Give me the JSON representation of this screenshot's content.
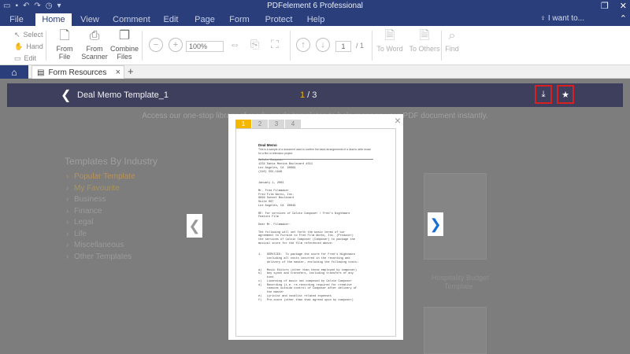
{
  "titlebar": {
    "title": "PDFelement 6 Professional",
    "quick_access": [
      "folder-icon",
      "save-icon",
      "undo-icon",
      "redo-icon",
      "clock-icon",
      "dropdown-icon"
    ],
    "window_buttons": [
      "restore-icon",
      "close-icon"
    ]
  },
  "menu": {
    "items": [
      "File",
      "Home",
      "View",
      "Comment",
      "Edit",
      "Page",
      "Form",
      "Protect",
      "Help"
    ],
    "active": "Home",
    "search_hint": "I want to...",
    "minimize": "⌃"
  },
  "ribbon": {
    "select_label": "Select",
    "hand_label": "Hand",
    "edit_label": "Edit",
    "from_file": "From File",
    "from_scanner_1": "From",
    "from_scanner_2": "Scanner",
    "combine_1": "Combine",
    "combine_2": "Files",
    "zoom_value": "100%",
    "page_current": "1",
    "page_total": "/ 1",
    "to_word": "To Word",
    "to_others": "To Others",
    "find": "Find"
  },
  "tabs": {
    "doc_title": "Form Resources",
    "add": "+"
  },
  "viewer": {
    "template_name": "Deal Memo Template_1",
    "page_current": "1",
    "page_total": " / 3"
  },
  "background": {
    "banner": "Access our one-stop library of ready-made templates to help manage your PDF document instantly.",
    "heading": "Templates By Industry",
    "categories": [
      {
        "label": "Popular Template"
      },
      {
        "label": "My Favourite"
      },
      {
        "label": "Business"
      },
      {
        "label": "Finance"
      },
      {
        "label": "Legal"
      },
      {
        "label": "Life"
      },
      {
        "label": "Miscellaneous"
      },
      {
        "label": "Other Templates"
      }
    ],
    "card_caption_1": "Hospitality Budget",
    "card_caption_2": "Template"
  },
  "preview": {
    "tabs": [
      "1",
      "2",
      "3",
      "4"
    ],
    "active_tab": "1",
    "close": "×",
    "doc_heading": "Deal Memo",
    "doc_sub_1": "This is a sample of a document used to confirm the basic arrangements of a deal to write music",
    "doc_sub_2": "for a film or television project.",
    "doc_body": "Calvin Composer\n1234 Santa Monica Boulevard #311\nLos Angeles, CA  90099\n(310) 555-1948\n\n\nJanuary 1, 2003\n\nMr. Fred Filmmaker\nFred Film Works, Inc.\n9999 Sunset Boulevard\nSuite 007\nLos Angeles, CA  90049\n\nRE: For services of Calvin Composer / Fred's Nightmare\nFeature Film\n\nDear Mr. Filmmaker:\n\nThe following will set forth the basic terms of our\nagreement to furnish to Fred Film Works, Inc. (Producer)\nthe services of Calvin Composer (Composer) to package the\nmusical score for the film referenced above:\n\n\n1.   SERVICES:  To package the score for Fred's Nightmare\n     including all costs incurred in the recording and\n     delivery of the master, excluding the following costs:\n\na)   Music Editors (other than those employed by composer)\nb)   Any synch and transfers, including transfers of any\n     kind\nc)   Licensing of music not composed by Calvin Composer\nd)   Recording (i.e. re-recording required for creative\n     reasons outside control of Composer after delivery of\n     the master\ne)   Lyricist and vocalist related expenses\nf)   Pre-score (other than that agreed upon by composer)"
  }
}
